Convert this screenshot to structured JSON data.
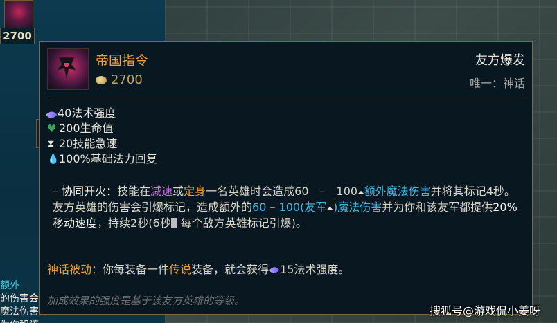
{
  "background": {
    "thumb_price": "2700",
    "underlay_lines": [
      "额外",
      "的伤害会",
      "魔法伤害并为你和该"
    ]
  },
  "tooltip": {
    "item_name": "帝国指令",
    "cost": "2700",
    "category": "友方爆发",
    "uniqueness": "唯一：神话",
    "stats": [
      {
        "icon": "ability-power-icon",
        "text": "40法术强度"
      },
      {
        "icon": "health-icon",
        "text": "200生命值"
      },
      {
        "icon": "ability-haste-icon",
        "text": "20技能急速"
      },
      {
        "icon": "mana-regen-icon",
        "text": "100%基础法力回复"
      }
    ],
    "passive": {
      "bullet": "–",
      "name": "协同开火：",
      "t1": "技能在",
      "slow": "减速",
      "t2": "或",
      "immobilize": "定身",
      "t3": "一名英雄时会造成60　–　100",
      "bonus_magic": "额外魔法伤害",
      "t4": "并将其标记4秒。友方英雄的伤害会引爆标记，造成额外的",
      "dmg_range": "60 – 100(友军",
      "dmg_close": ")魔法伤害",
      "t5": "并为你和该友军都提供",
      "ms": "20%移动速度",
      "t6": "，持续2秒(6秒",
      "t7": "每个敌方英雄标记引爆)。"
    },
    "mythic": {
      "label": "神话被动：",
      "t1": "你每装备一件",
      "legendary": "传说",
      "t2": "装备，就会获得",
      "t3": "15法术强度。"
    },
    "note": "加成效果的强度是基于该友方英雄的等级。"
  },
  "watermark": "搜狐号@游戏侃小姜呀",
  "colors": {
    "gold_accent": "#f0a035",
    "cyan_highlight": "#45b8e0",
    "purple_highlight": "#cf6fe0",
    "border": "#7a6a45"
  }
}
